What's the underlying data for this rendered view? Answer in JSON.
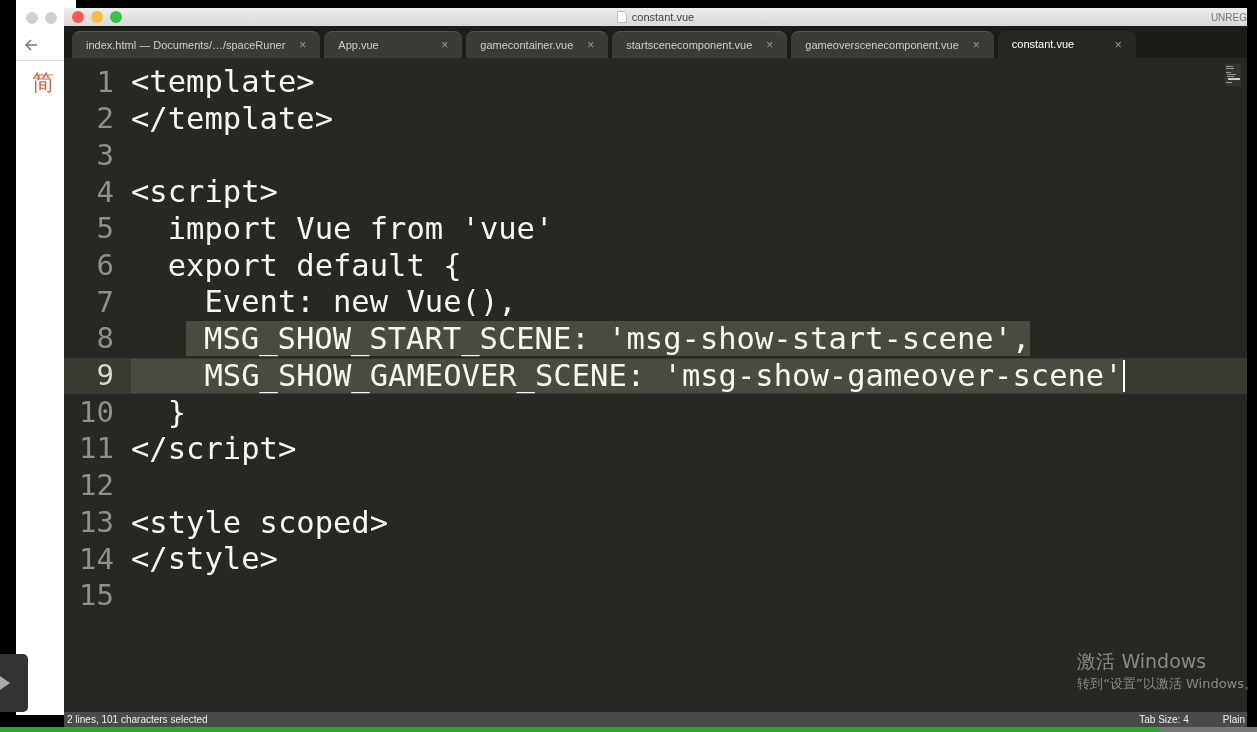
{
  "background_window": {
    "heading": "简"
  },
  "window": {
    "title": "constant.vue",
    "registration": "UNREG"
  },
  "tabs": [
    {
      "label": "index.html — Documents/…/spaceRuner",
      "selected": false
    },
    {
      "label": "App.vue",
      "selected": false
    },
    {
      "label": "gamecontainer.vue",
      "selected": false
    },
    {
      "label": "startscenecomponent.vue",
      "selected": false
    },
    {
      "label": "gameoverscenecomponent.vue",
      "selected": false
    },
    {
      "label": "constant.vue",
      "selected": true
    }
  ],
  "tab_close": "×",
  "lines": [
    {
      "number": "1",
      "text": "<template>",
      "selected": false,
      "current": false
    },
    {
      "number": "2",
      "text": "</template>",
      "selected": false,
      "current": false
    },
    {
      "number": "3",
      "selected": false,
      "current": false
    },
    {
      "number": "4",
      "text": "<script>",
      "selected": false,
      "current": false
    },
    {
      "number": "5",
      "text": "  import Vue from 'vue'",
      "selected": false,
      "current": false
    },
    {
      "number": "6",
      "text": "  export default {",
      "selected": false,
      "current": false
    },
    {
      "number": "7",
      "text": "    Event: new Vue(),",
      "selected": false,
      "current": false
    },
    {
      "number": "8",
      "text": "    MSG_SHOW_START_SCENE: 'msg-show-start-scene',",
      "selected": true,
      "current": false
    },
    {
      "number": "9",
      "text": "    MSG_SHOW_GAMEOVER_SCENE: 'msg-show-gameover-scene'",
      "selected": true,
      "current": true
    },
    {
      "number": "10",
      "text": "  }",
      "selected": false,
      "current": false
    },
    {
      "number": "11",
      "text": "</script>",
      "selected": false,
      "current": false
    },
    {
      "number": "12",
      "selected": false,
      "current": false
    },
    {
      "number": "13",
      "text": "<style scoped>",
      "selected": false,
      "current": false
    },
    {
      "number": "14",
      "text": "</style>",
      "selected": false,
      "current": false
    },
    {
      "number": "15",
      "selected": false,
      "current": false
    }
  ],
  "activation_notice": {
    "title": "激活 Windows",
    "message": "转到“设置”以激活 Windows。"
  },
  "status_bar": {
    "selection": "2 lines, 101 characters selected",
    "tab_size": "Tab Size: 4",
    "syntax": "Plain"
  }
}
